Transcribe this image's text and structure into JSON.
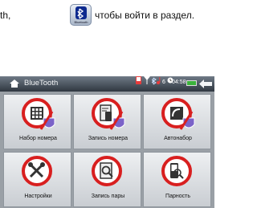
{
  "instruction": {
    "left_text": "th,",
    "right_text": "чтобы войти в раздел.",
    "button_caption": "Bluetooth"
  },
  "header": {
    "title": "BlueTooth",
    "counter": "6",
    "time": "04:58"
  },
  "tiles": [
    {
      "label": "Набор номера",
      "icon": "keypad-icon"
    },
    {
      "label": "Запись номера",
      "icon": "phonebook-icon"
    },
    {
      "label": "Автонабор",
      "icon": "autodial-icon"
    },
    {
      "label": "Настройки",
      "icon": "settings-tools-icon"
    },
    {
      "label": "Запись пары",
      "icon": "pair-record-icon"
    },
    {
      "label": "Парность",
      "icon": "pairing-icon"
    }
  ],
  "colors": {
    "ring_red": "#d81f1f",
    "badge_purple": "#7b63c8",
    "titlebar_dark": "#2f3740"
  }
}
